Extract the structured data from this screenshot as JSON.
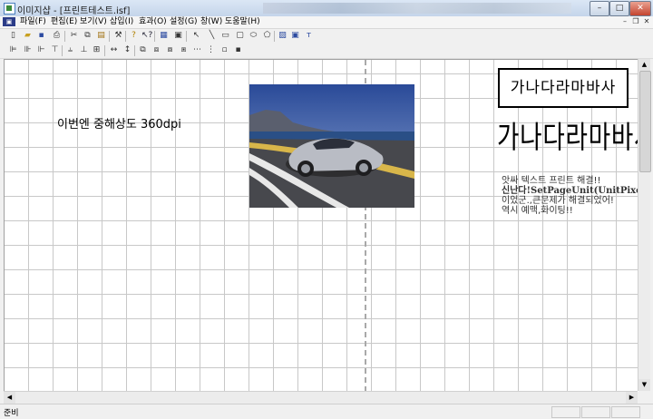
{
  "window": {
    "title": "이미지샵 - [프린트테스트.isf]"
  },
  "menubar": {
    "items": [
      "파일(F)",
      "편집(E)",
      "보기(V)",
      "삽입(I)",
      "효과(O)",
      "설정(G)",
      "창(W)",
      "도움말(H)"
    ]
  },
  "toolbar": {
    "icons": [
      "new-icon",
      "open-icon",
      "save-icon",
      "print-icon",
      "cut-icon",
      "copy-icon",
      "paste-icon",
      "tools-icon",
      "help-icon",
      "context-help-icon",
      "grid-icon",
      "property-icon",
      "select-icon",
      "line-icon",
      "rect-icon",
      "roundrect-icon",
      "ellipse-icon",
      "polygon-icon",
      "image-icon",
      "frame-icon",
      "text-icon"
    ]
  },
  "document": {
    "resolution_text": "이번엔 중해상도 360dpi",
    "boxed_text": "가나다라마바사",
    "tall_text": "가나다라마바사",
    "notes": [
      "앗싸 텍스트 프린트 해결!!",
      "신난다!SetPageUnit(UnitPixel)",
      "이었군.,큰문제가 해결되었어!",
      "역시 예맥,화이팅!!"
    ]
  },
  "status": {
    "ready": "준비"
  },
  "colors": {
    "title_gradient_top": "#dbe7f5",
    "canvas_grid": "#c8c8c8",
    "close_button": "#c4442e"
  }
}
